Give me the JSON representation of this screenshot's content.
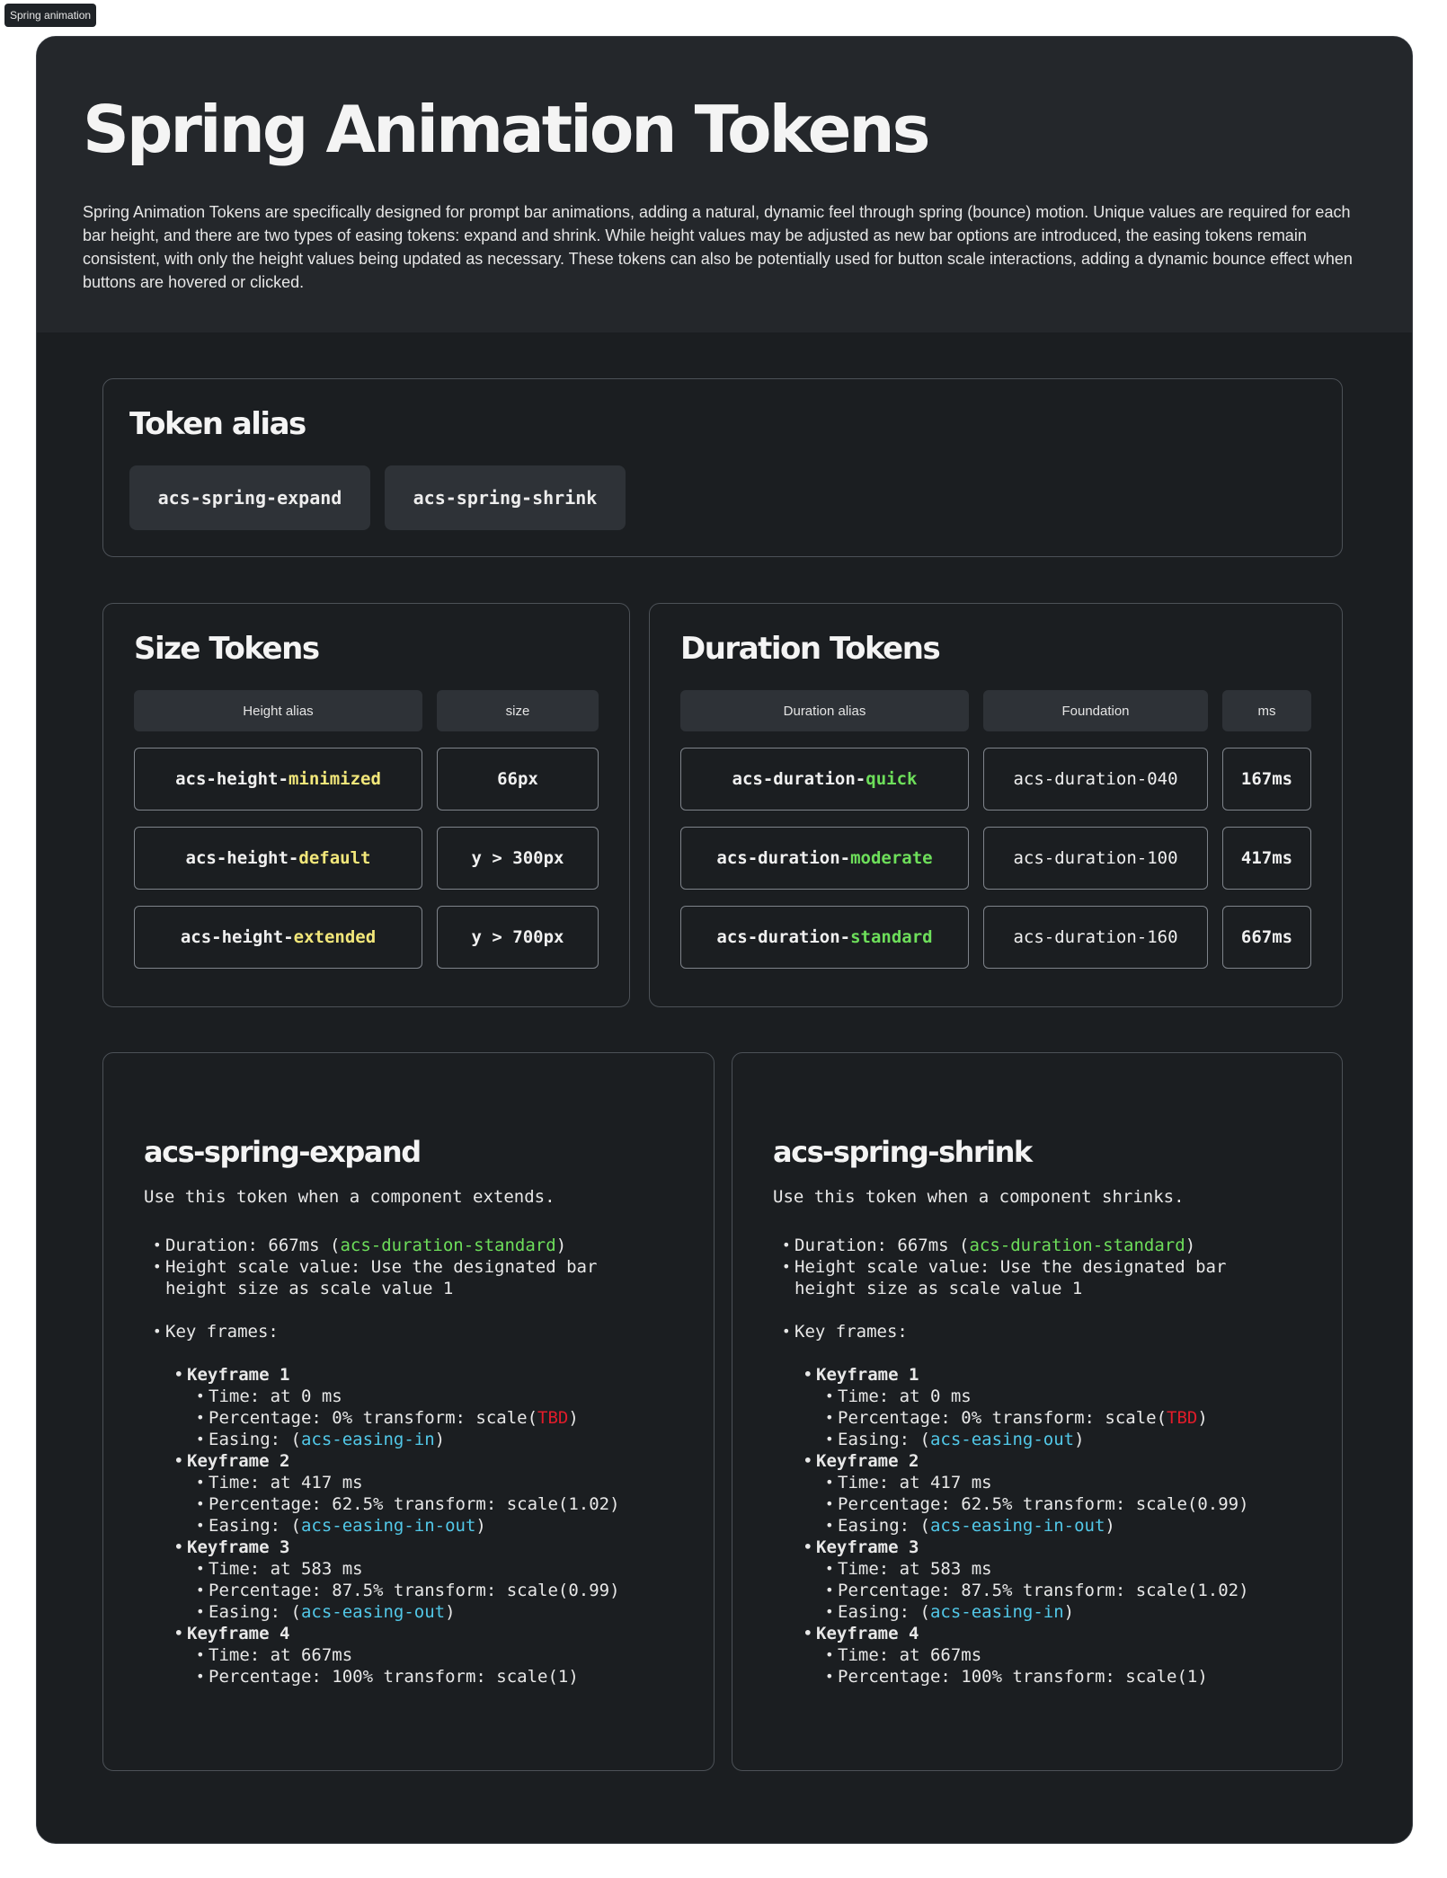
{
  "frame_label": "Spring animation",
  "header": {
    "title": "Spring Animation Tokens",
    "description": "Spring Animation Tokens are specifically designed for prompt bar animations, adding a natural, dynamic feel through spring (bounce) motion. Unique values are required for each bar height, and there are two types of easing tokens: expand and shrink. While height values may be adjusted as new bar options are introduced, the easing tokens remain consistent, with only the height values being updated as necessary. These tokens can also be potentially used for button scale interactions, adding a dynamic bounce effect when buttons are hovered or clicked."
  },
  "token_alias": {
    "title": "Token alias",
    "chips": [
      "acs-spring-expand",
      "acs-spring-shrink"
    ]
  },
  "size_tokens": {
    "title": "Size Tokens",
    "headers": [
      "Height alias",
      "size"
    ],
    "rows": [
      {
        "prefix": "acs-height-",
        "accent": "minimized",
        "size": "66px"
      },
      {
        "prefix": "acs-height-",
        "accent": "default",
        "size": "y > 300px"
      },
      {
        "prefix": "acs-height-",
        "accent": "extended",
        "size": "y > 700px"
      }
    ]
  },
  "duration_tokens": {
    "title": "Duration Tokens",
    "headers": [
      "Duration alias",
      "Foundation",
      "ms"
    ],
    "rows": [
      {
        "prefix": "acs-duration-",
        "accent": "quick",
        "foundation": "acs-duration-040",
        "ms": "167ms"
      },
      {
        "prefix": "acs-duration-",
        "accent": "moderate",
        "foundation": "acs-duration-100",
        "ms": "417ms"
      },
      {
        "prefix": "acs-duration-",
        "accent": "standard",
        "foundation": "acs-duration-160",
        "ms": "667ms"
      }
    ]
  },
  "colors": {
    "height_accent": "#f2e77a",
    "duration_accent": "#6dde5a",
    "easing": "#52c8e8",
    "tbd": "#e01c2a"
  },
  "expand": {
    "title": "acs-spring-expand",
    "lead": "Use this token when a component extends.",
    "duration_label": "Duration: 667ms (",
    "duration_token": "acs-duration-standard",
    "duration_close": ")",
    "height_scale_line1": "Height scale value: Use the designated bar",
    "height_scale_line2": "height size as scale value 1",
    "keyframes_label": "Key frames:",
    "keyframes": [
      {
        "title": "Keyframe 1",
        "time": "Time: at 0 ms",
        "pct_pre": "Percentage: 0% transform: scale(",
        "pct_tbd": "TBD",
        "pct_post": ")",
        "easing_pre": "Easing: (",
        "easing": "acs-easing-in",
        "easing_post": ")"
      },
      {
        "title": "Keyframe 2",
        "time": "Time: at 417 ms",
        "pct": "Percentage: 62.5% transform: scale(1.02)",
        "easing_pre": "Easing: (",
        "easing": "acs-easing-in-out",
        "easing_post": ")"
      },
      {
        "title": "Keyframe 3",
        "time": "Time: at 583 ms",
        "pct": "Percentage: 87.5% transform: scale(0.99)",
        "easing_pre": "Easing: (",
        "easing": "acs-easing-out",
        "easing_post": ")"
      },
      {
        "title": "Keyframe 4",
        "time": "Time: at 667ms",
        "pct": "Percentage: 100% transform: scale(1)"
      }
    ]
  },
  "shrink": {
    "title": "acs-spring-shrink",
    "lead": "Use this token when a component shrinks.",
    "duration_label": "Duration: 667ms (",
    "duration_token": "acs-duration-standard",
    "duration_close": ")",
    "height_scale_line1": "Height scale value: Use the designated bar",
    "height_scale_line2": "height size as scale value 1",
    "keyframes_label": "Key frames:",
    "keyframes": [
      {
        "title": "Keyframe 1",
        "time": "Time: at 0 ms",
        "pct_pre": "Percentage: 0% transform: scale(",
        "pct_tbd": "TBD",
        "pct_post": ")",
        "easing_pre": "Easing: (",
        "easing": "acs-easing-out",
        "easing_post": ")"
      },
      {
        "title": "Keyframe 2",
        "time": "Time: at 417 ms",
        "pct": "Percentage: 62.5% transform: scale(0.99)",
        "easing_pre": "Easing: (",
        "easing": "acs-easing-in-out",
        "easing_post": ")"
      },
      {
        "title": "Keyframe 3",
        "time": "Time: at 583 ms",
        "pct": "Percentage: 87.5% transform: scale(1.02)",
        "easing_pre": "Easing: (",
        "easing": "acs-easing-in",
        "easing_post": ")"
      },
      {
        "title": "Keyframe 4",
        "time": "Time: at 667ms",
        "pct": "Percentage: 100% transform: scale(1)"
      }
    ]
  }
}
